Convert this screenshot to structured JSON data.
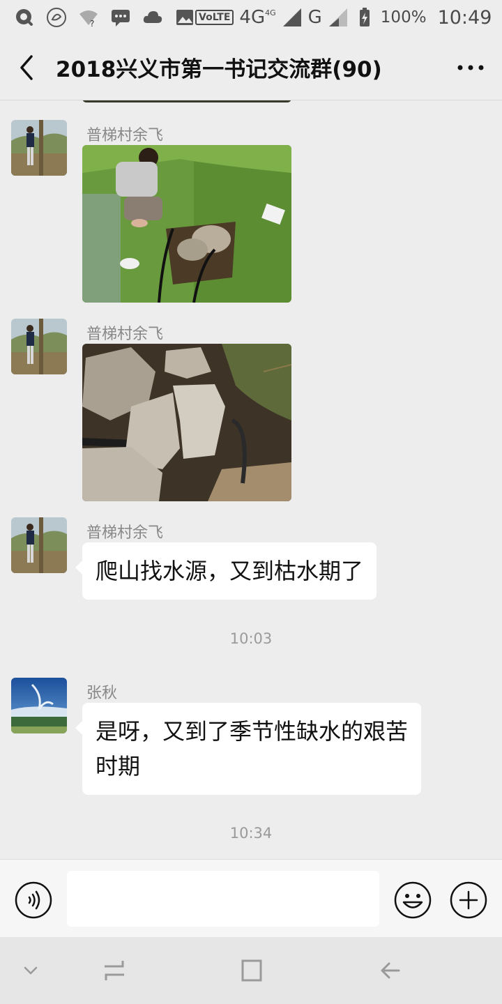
{
  "status_bar": {
    "network_label": "VoLTE",
    "signal_1": "4G",
    "signal_1_sup": "4G",
    "signal_2": "G",
    "battery": "100%",
    "time": "10:49"
  },
  "header": {
    "title": "2018兴义市第一书记交流群(90)",
    "back_icon": "chevron-left-icon",
    "more_icon": "more-dots-icon"
  },
  "messages": [
    {
      "type": "image",
      "sender": "普梯村余飞",
      "image": "photo-man-crouching-by-water-source"
    },
    {
      "type": "image",
      "sender": "普梯村余飞",
      "image": "photo-rocks-and-water-pipe"
    },
    {
      "type": "text",
      "sender": "普梯村余飞",
      "text": "爬山找水源，又到枯水期了"
    },
    {
      "type": "time",
      "text": "10:03"
    },
    {
      "type": "text",
      "sender": "张秋",
      "text_line1": "是呀，又到了季节性缺水的艰苦",
      "text_line2": "时期"
    },
    {
      "type": "time",
      "text": "10:34"
    }
  ],
  "input_bar": {
    "voice_icon": "voice-icon",
    "input_value": "",
    "emoji_icon": "emoji-icon",
    "plus_icon": "plus-icon"
  },
  "nav_bar": {
    "icons": [
      "nav-down-icon",
      "nav-recents-icon",
      "nav-home-icon",
      "nav-back-icon"
    ]
  },
  "colors": {
    "background": "#ededed",
    "bubble": "#ffffff",
    "meta_text": "#888888"
  }
}
